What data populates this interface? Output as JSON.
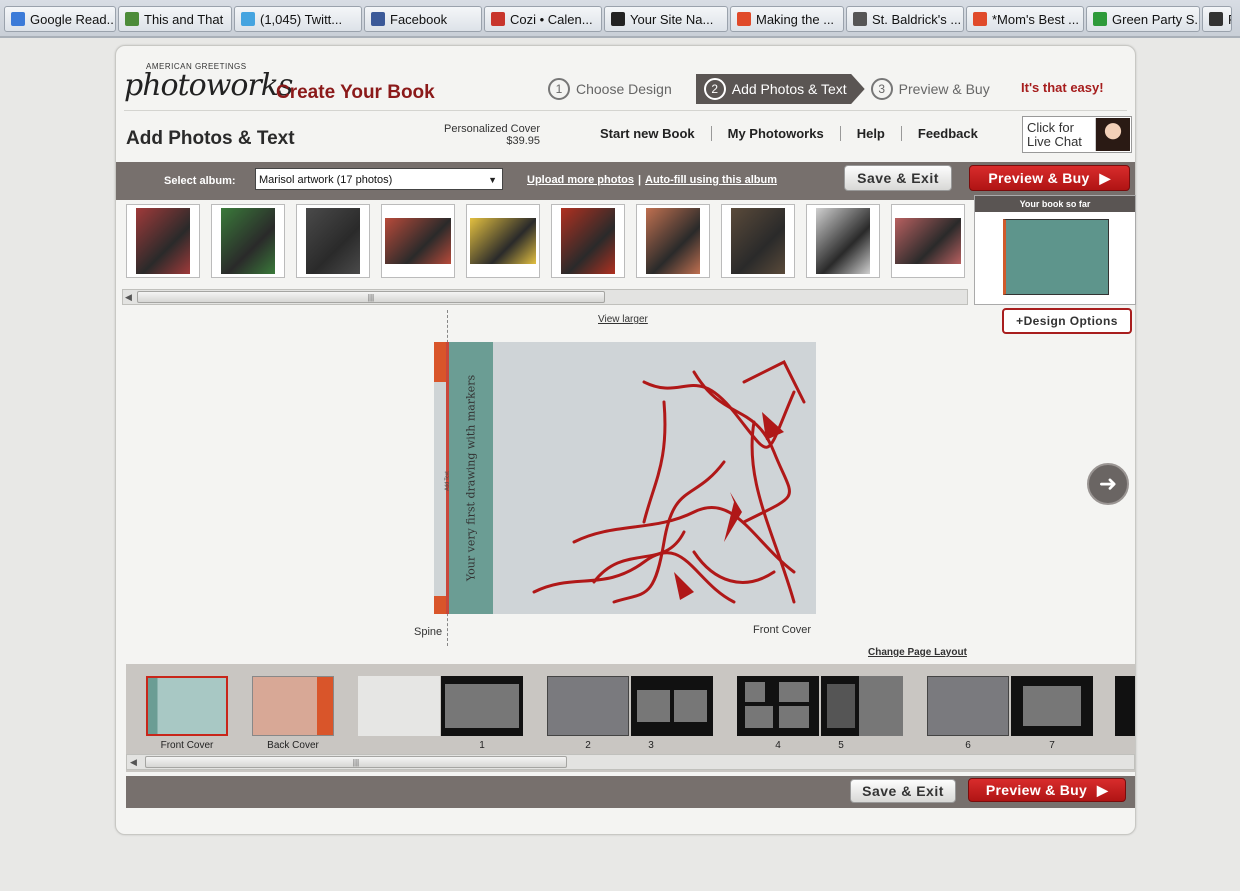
{
  "bookmarks": [
    {
      "label": "Google Read...",
      "color": "#3b7ad8"
    },
    {
      "label": "This and That",
      "color": "#4d8c3a"
    },
    {
      "label": "(1,045) Twitt...",
      "color": "#45a4e0"
    },
    {
      "label": "Facebook",
      "color": "#3b5998"
    },
    {
      "label": "Cozi • Calen...",
      "color": "#c8352c"
    },
    {
      "label": "Your Site Na...",
      "color": "#222222"
    },
    {
      "label": "Making the ...",
      "color": "#e04a2a"
    },
    {
      "label": "St. Baldrick's ...",
      "color": "#555555"
    },
    {
      "label": "*Mom's Best ...",
      "color": "#e04a2a"
    },
    {
      "label": "Green Party S...",
      "color": "#2e9a3a"
    },
    {
      "label": "P",
      "color": "#333333"
    }
  ],
  "header": {
    "logo_small": "AMERICAN GREETINGS",
    "logo_big": "photoworks",
    "title": "Create Your Book",
    "steps": [
      {
        "num": "1",
        "label": "Choose Design"
      },
      {
        "num": "2",
        "label": "Add Photos & Text"
      },
      {
        "num": "3",
        "label": "Preview & Buy"
      }
    ],
    "tagline": "It's that easy!"
  },
  "subheader": {
    "page_title": "Add Photos & Text",
    "price_label": "Personalized Cover",
    "price": "$39.95",
    "nav": [
      "Start new Book",
      "My Photoworks",
      "Help",
      "Feedback"
    ],
    "chat_line1": "Click for",
    "chat_line2": "Live Chat"
  },
  "album": {
    "select_label": "Select album:",
    "selected": "Marisol artwork (17 photos)",
    "upload_link": "Upload more photos",
    "autofill_link": "Auto-fill using this album",
    "save_exit": "Save & Exit",
    "preview_buy": "Preview & Buy"
  },
  "photos": [
    "#a03a3a",
    "#3a7a3a",
    "#4a4a4a",
    "#b84a3a",
    "#e3c040",
    "#b03020",
    "#c07050",
    "#5a4a3a",
    "#d0d0d0",
    "#b86060"
  ],
  "book_so_far": {
    "label": "Your book so far"
  },
  "design_options": "+Design Options",
  "view_larger": "View larger",
  "cover": {
    "spine_text": "Add Text",
    "title_text": "Your very first drawing with markers",
    "spine_label": "Spine",
    "front_label": "Front Cover"
  },
  "change_layout": "Change Page Layout",
  "pages": {
    "front_cover": "Front Cover",
    "back_cover": "Back Cover",
    "numbers": [
      "1",
      "2",
      "3",
      "4",
      "5",
      "6",
      "7"
    ]
  },
  "footer": {
    "save_exit": "Save & Exit",
    "preview_buy": "Preview & Buy"
  }
}
